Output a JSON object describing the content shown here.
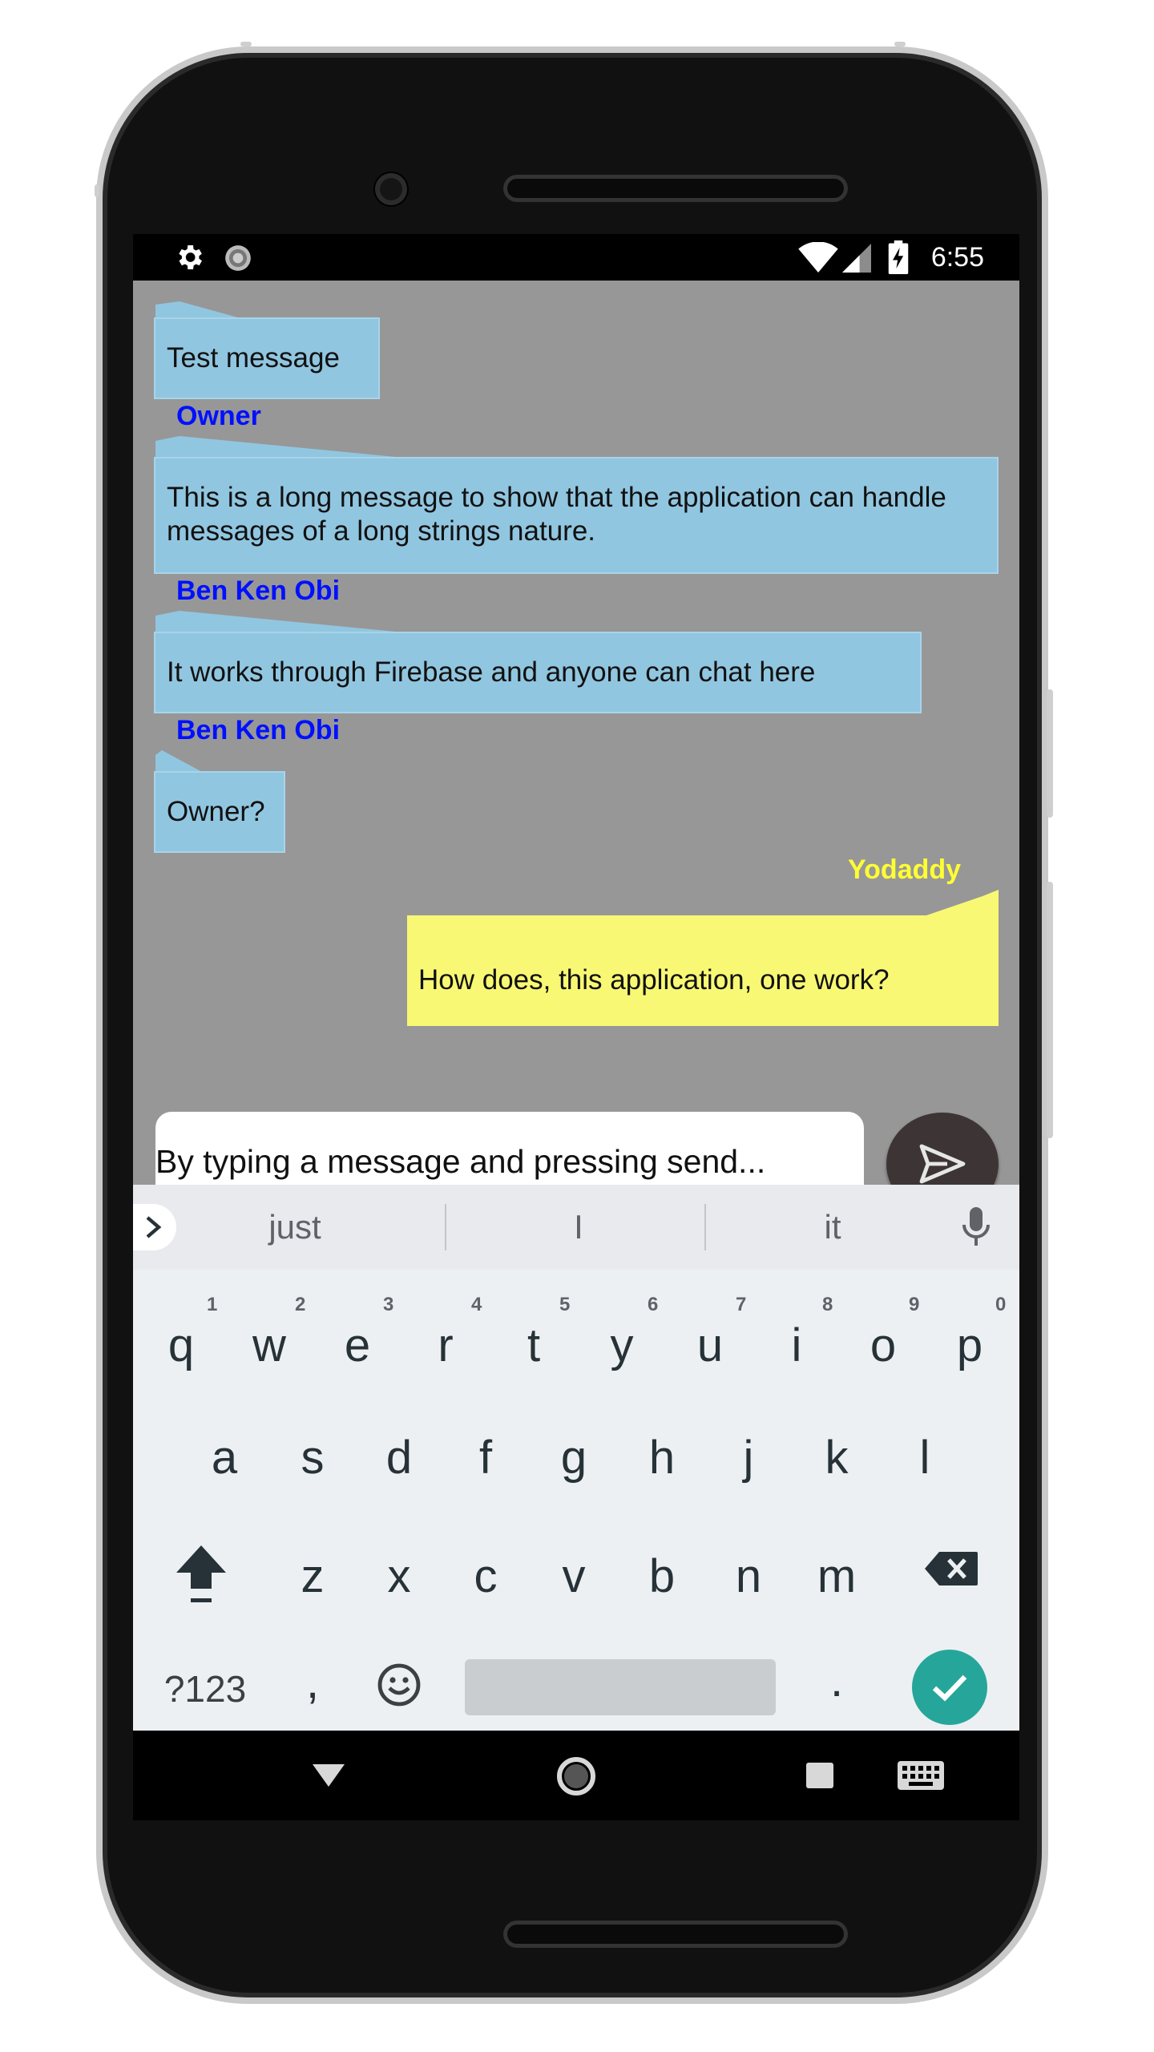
{
  "status_bar": {
    "time": "6:55",
    "left_icons": [
      "gear-icon",
      "sync-icon"
    ],
    "right_icons": [
      "wifi-icon",
      "signal-icon",
      "battery-charging-icon"
    ]
  },
  "chat": {
    "messages": [
      {
        "text": "Test message",
        "side": "incoming"
      },
      {
        "sender": "Owner",
        "text": "This is a long message to show that the application can handle messages of a long strings nature.",
        "side": "incoming"
      },
      {
        "sender": "Ben Ken Obi",
        "text": "It works through Firebase and anyone can chat here",
        "side": "incoming"
      },
      {
        "sender": "Ben Ken Obi",
        "text": "Owner?",
        "side": "incoming"
      },
      {
        "sender": "Yodaddy",
        "text": "How does, this application, one work?",
        "side": "outgoing"
      }
    ],
    "input": {
      "value": "By typing a message and pressing send...",
      "placeholder": ""
    },
    "send_icon": "send-icon",
    "colors": {
      "background": "#979797",
      "incoming_bubble": "#91c6e0",
      "outgoing_bubble": "#f8f874",
      "sender_name": "#0010ff",
      "own_sender_name": "#ffff33"
    }
  },
  "keyboard": {
    "suggestions": [
      "just",
      "I",
      "it"
    ],
    "row1": [
      "q",
      "w",
      "e",
      "r",
      "t",
      "y",
      "u",
      "i",
      "o",
      "p"
    ],
    "row1_hints": [
      "1",
      "2",
      "3",
      "4",
      "5",
      "6",
      "7",
      "8",
      "9",
      "0"
    ],
    "row2": [
      "a",
      "s",
      "d",
      "f",
      "g",
      "h",
      "j",
      "k",
      "l"
    ],
    "row3": [
      "z",
      "x",
      "c",
      "v",
      "b",
      "n",
      "m"
    ],
    "symbols_key": "?123",
    "comma_key": ",",
    "period_key": ".",
    "accent_color": "#26a69a"
  },
  "nav_bar": {
    "icons": [
      "back-icon",
      "home-icon",
      "recents-icon",
      "keyboard-switch-icon"
    ]
  }
}
